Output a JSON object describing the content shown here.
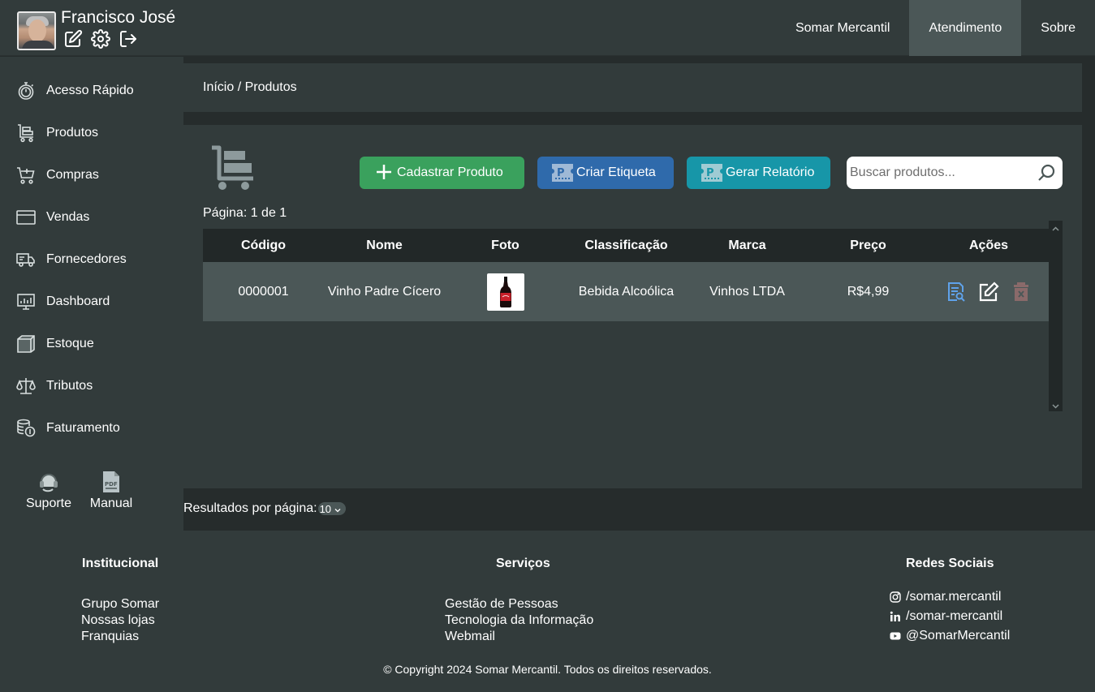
{
  "user": {
    "name": "Francisco José"
  },
  "topnav": [
    {
      "label": "Somar Mercantil",
      "active": false
    },
    {
      "label": "Atendimento",
      "active": true
    },
    {
      "label": "Sobre",
      "active": false
    }
  ],
  "sidebar": {
    "items": [
      {
        "label": "Acesso Rápido",
        "icon": "stopwatch-icon"
      },
      {
        "label": "Produtos",
        "icon": "cart-icon"
      },
      {
        "label": "Compras",
        "icon": "cart-plus-icon"
      },
      {
        "label": "Vendas",
        "icon": "credit-card-icon"
      },
      {
        "label": "Fornecedores",
        "icon": "truck-icon"
      },
      {
        "label": "Dashboard",
        "icon": "monitor-icon"
      },
      {
        "label": "Estoque",
        "icon": "box-icon"
      },
      {
        "label": "Tributos",
        "icon": "scale-icon"
      },
      {
        "label": "Faturamento",
        "icon": "coins-icon"
      }
    ],
    "bottom": [
      {
        "label": "Suporte",
        "icon": "headset-icon"
      },
      {
        "label": "Manual",
        "icon": "pdf-icon"
      }
    ]
  },
  "breadcrumb": "Início / Produtos",
  "toolbar": {
    "add_label": "Cadastrar Produto",
    "label_label": "Criar Etiqueta",
    "report_label": "Gerar Relatório",
    "search_placeholder": "Buscar produtos..."
  },
  "pagination": {
    "page_info": "Página: 1 de 1"
  },
  "table": {
    "columns": [
      "Código",
      "Nome",
      "Foto",
      "Classificação",
      "Marca",
      "Preço",
      "Ações"
    ],
    "rows": [
      {
        "code": "0000001",
        "name": "Vinho Padre Cícero",
        "classification": "Bebida Alcoólica",
        "brand": "Vinhos LTDA",
        "price": "R$4,99"
      }
    ]
  },
  "per_page": {
    "label": "Resultados por página:",
    "value": "10"
  },
  "footer": {
    "institucional": {
      "title": "Institucional",
      "links": [
        "Grupo Somar",
        "Nossas lojas",
        "Franquias"
      ]
    },
    "servicos": {
      "title": "Serviços",
      "links": [
        "Gestão de Pessoas",
        "Tecnologia da Informação",
        "Webmail"
      ]
    },
    "redes": {
      "title": "Redes Sociais",
      "links": [
        "/somar.mercantil",
        "/somar-mercantil",
        "@SomarMercantil"
      ]
    },
    "copyright": "© Copyright 2024 Somar Mercantil. Todos os direitos reservados."
  },
  "colors": {
    "header": "#323b3b",
    "background": "#262c2c",
    "active_nav": "#4b5757",
    "green": "#3aa15d",
    "blue": "#2f6aab",
    "cyan": "#1796a8"
  }
}
